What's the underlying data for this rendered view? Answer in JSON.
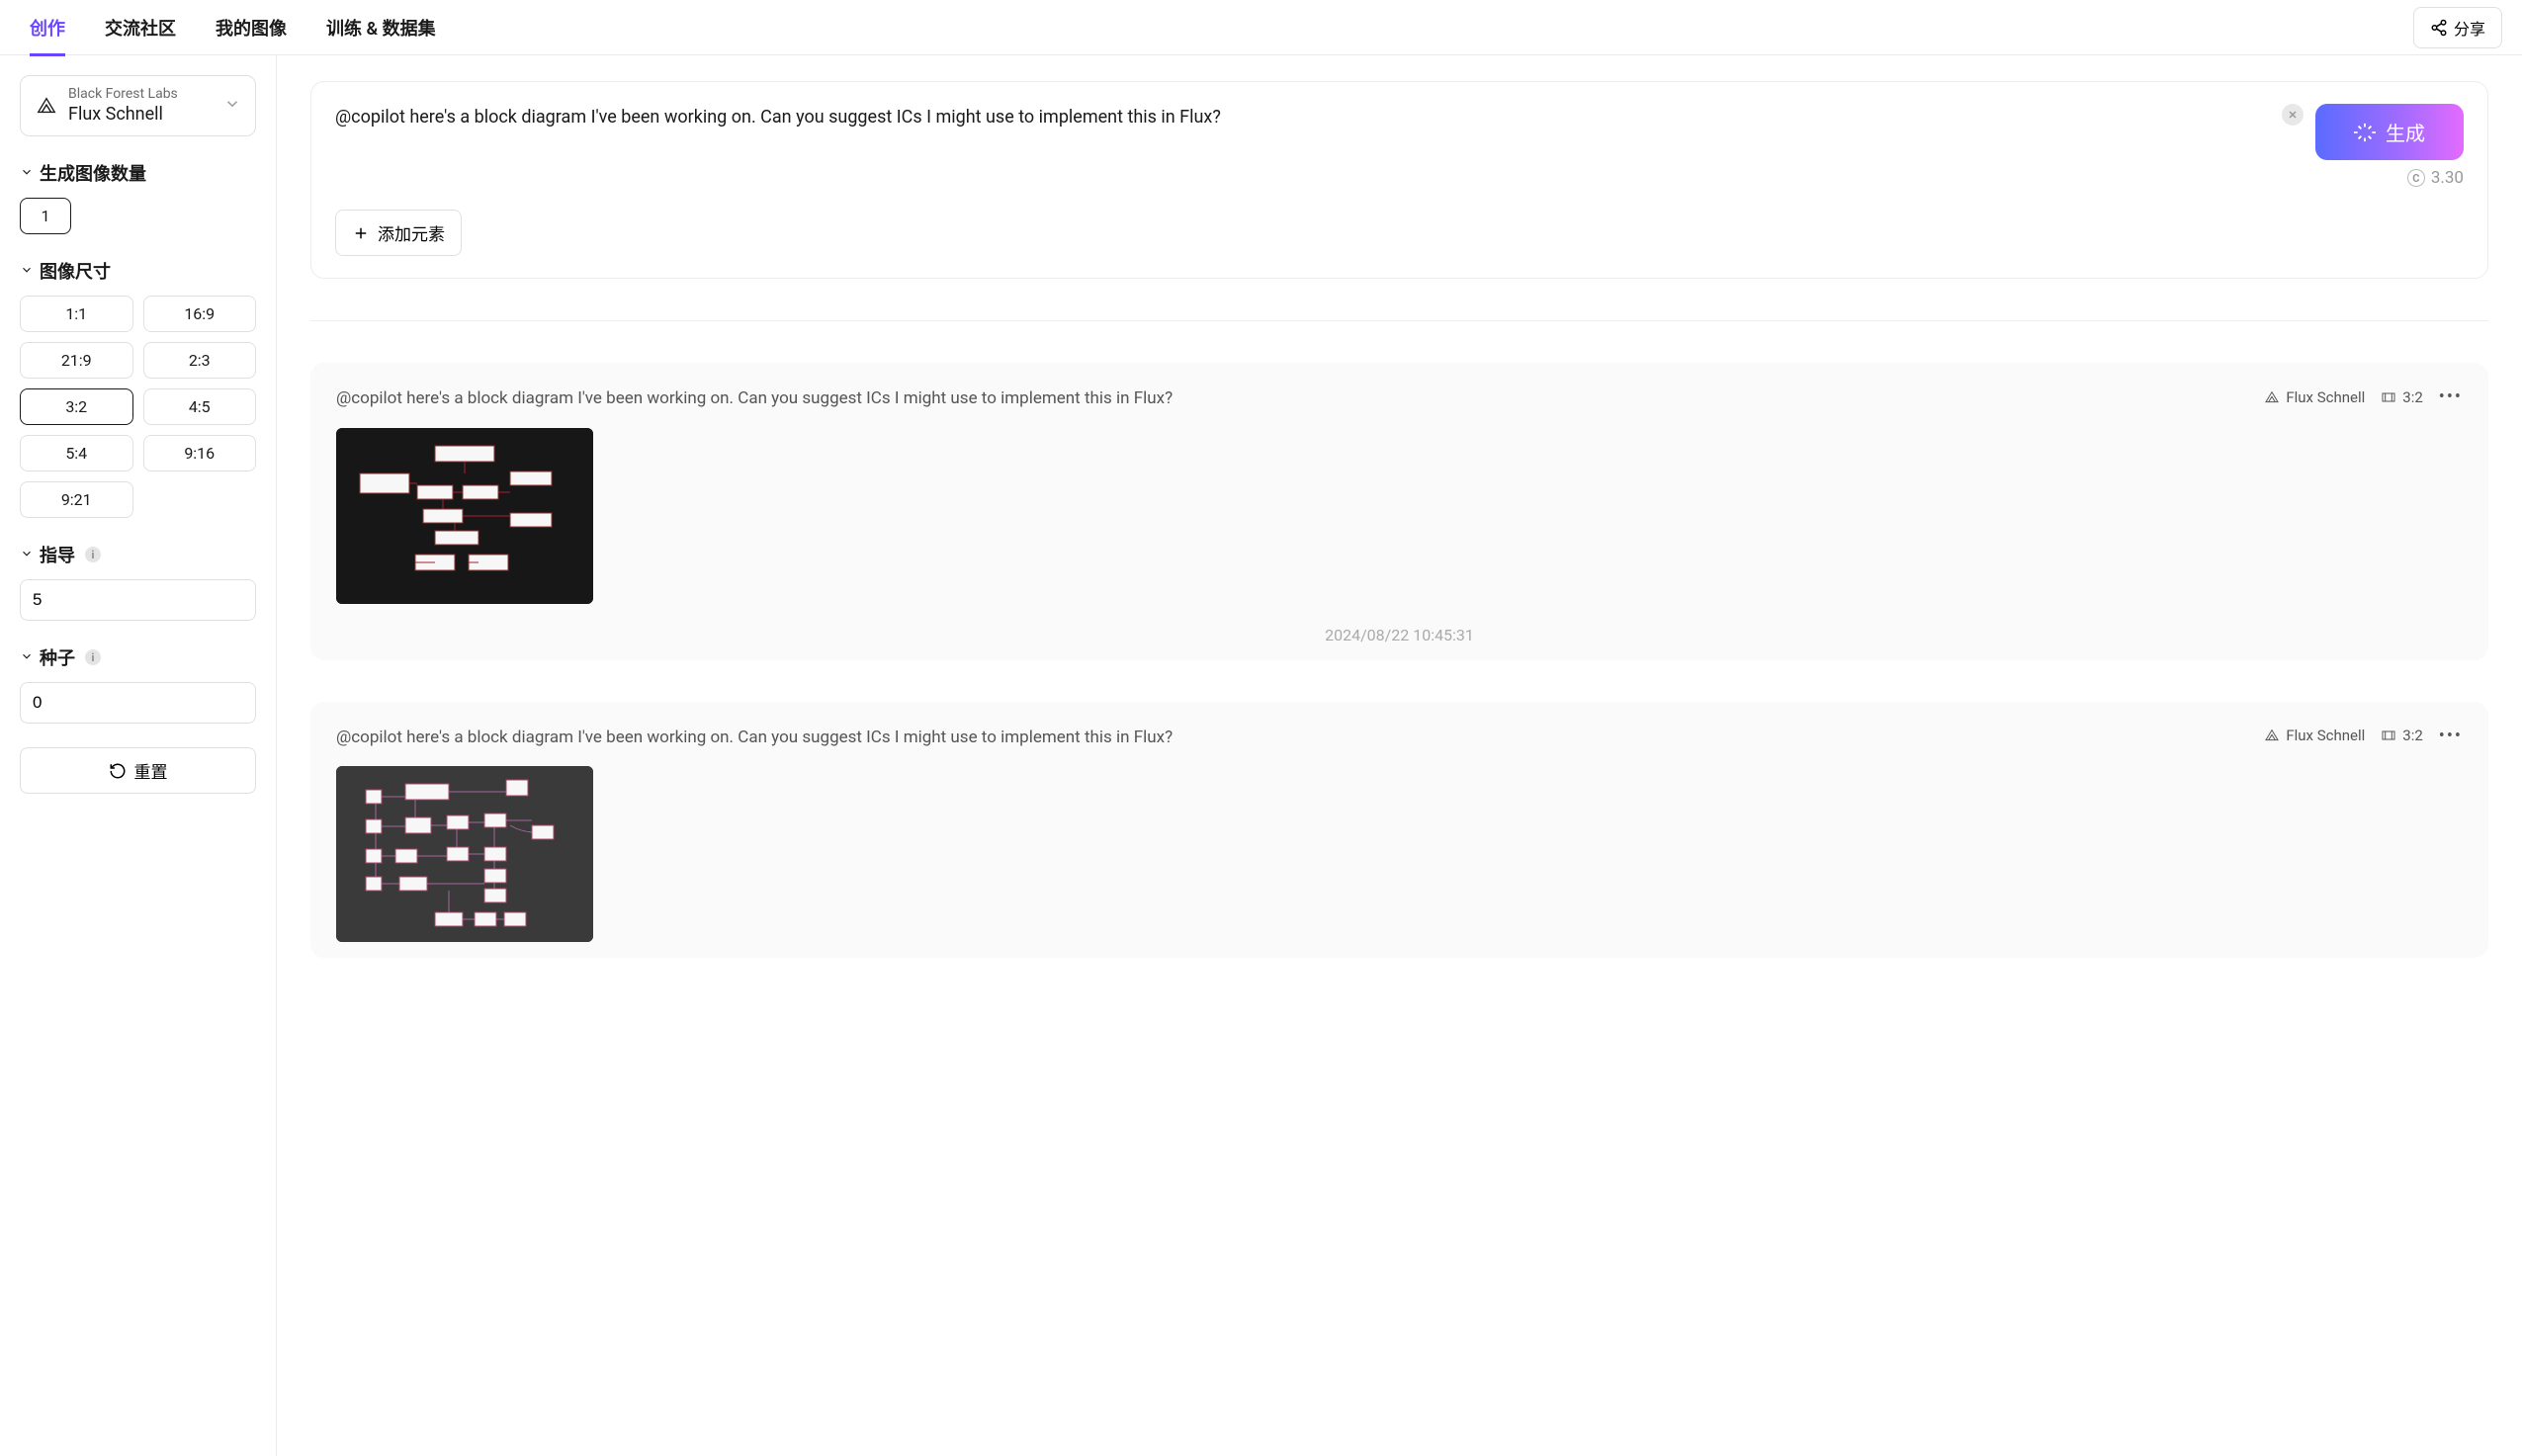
{
  "tabs": {
    "items": [
      "创作",
      "交流社区",
      "我的图像",
      "训练 & 数据集"
    ],
    "active_index": 0
  },
  "share_label": "分享",
  "model_selector": {
    "vendor": "Black Forest Labs",
    "model": "Flux Schnell"
  },
  "sidebar": {
    "image_count": {
      "label": "生成图像数量",
      "options": [
        "1"
      ],
      "selected": "1"
    },
    "image_size": {
      "label": "图像尺寸",
      "options": [
        "1:1",
        "16:9",
        "21:9",
        "2:3",
        "3:2",
        "4:5",
        "5:4",
        "9:16",
        "9:21"
      ],
      "selected": "3:2"
    },
    "guidance": {
      "label": "指导",
      "value": "5"
    },
    "seed": {
      "label": "种子",
      "value": "0"
    },
    "reset_label": "重置"
  },
  "prompt_box": {
    "text": "@copilot here's a block diagram I've been working on. Can you suggest ICs I might use to implement this in Flux?",
    "add_element_label": "添加元素",
    "generate_label": "生成",
    "credit_cost": "3.30"
  },
  "history": [
    {
      "prompt": "@copilot here's a block diagram I've been working on. Can you suggest ICs I might use to implement this in Flux?",
      "model": "Flux Schnell",
      "ratio": "3:2",
      "timestamp": "2024/08/22 10:45:31"
    },
    {
      "prompt": "@copilot here's a block diagram I've been working on. Can you suggest ICs I might use to implement this in Flux?",
      "model": "Flux Schnell",
      "ratio": "3:2",
      "timestamp": ""
    }
  ]
}
